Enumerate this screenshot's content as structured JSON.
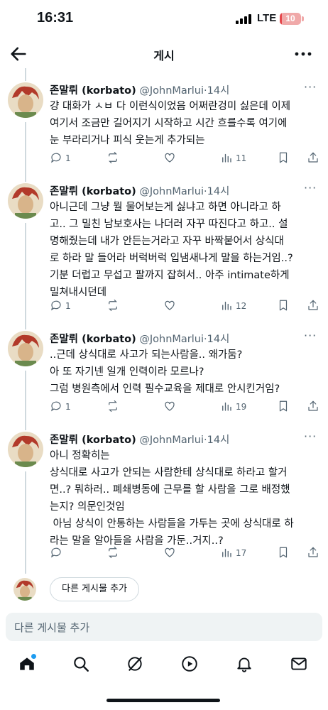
{
  "status_bar": {
    "time": "16:31",
    "network": "LTE",
    "battery": "10",
    "battery_level_percent": 10
  },
  "nav": {
    "title": "게시",
    "back_icon": "back-arrow-icon",
    "more_icon": "more-horizontal-icon"
  },
  "author": {
    "name": "존말뤼 (korbato)",
    "handle": "@JohnMarlui",
    "separator": "·",
    "time": "14시"
  },
  "tweets": [
    {
      "text": "걍 대화가 ㅅㅂ 다 이런식이었음 어쩌란겅미 싫은데 이제\n여기서 조금만 길어지기 시작하고 시간 흐를수록 여기에\n눈 부라리거나 피식 웃는게 추가되는",
      "replies": "1",
      "reposts": "",
      "likes": "",
      "views": "11"
    },
    {
      "text": "아니근데 그냥 뭘 물어보는게 싫냐고 하면 아니라고 하\n고.. 그 밀친 남보호사는 나더러 자꾸 따진다고 하고.. 설\n명해줬는데 내가 안든는거라고 자꾸 바짝붙어서 상식대\n로 하라 말 들어라 버럭버럭 입냄새나게 말을 하는거임..?\n기분 더럽고 무섭고 팔까지 잡혀서.. 아주 intimate하게\n밀쳐내시던데",
      "replies": "1",
      "reposts": "",
      "likes": "",
      "views": "12"
    },
    {
      "text": "..근데 상식대로 사고가 되는사람을.. 왜가둠?\n아 또 자기넨 일개 인력이라 모르나?\n그럼 병원측에서 인력 필수교육을 제대로 안시킨거임?",
      "replies": "1",
      "reposts": "",
      "likes": "",
      "views": "19"
    },
    {
      "text": "아니 정확히는\n상식대로 사고가 안되는 사람한테 상식대로 하라고 할거\n면..? 뭐하러.. 폐쇄병동에 근무를 할 사람을 그로 배정했\n는지? 의문인것임\n 아님 상식이 안통하는 사람들을 가두는 곳에 상식대로 하\n라는 말을 알아들을 사람을 가둔..거지..?",
      "replies": "",
      "reposts": "",
      "likes": "",
      "views": "17"
    }
  ],
  "reply_row": {
    "button_label": "다른 게시물 추가"
  },
  "composer": {
    "placeholder": "다른 게시물 추가"
  },
  "tab_bar": {
    "items": [
      "home-icon",
      "search-icon",
      "grok-icon",
      "video-icon",
      "notifications-icon",
      "messages-icon"
    ]
  },
  "colors": {
    "text": "#0f1419",
    "secondary": "#536471",
    "accent": "#1d9bf0",
    "divider": "#cfd9de",
    "battery": "#e5484d"
  }
}
